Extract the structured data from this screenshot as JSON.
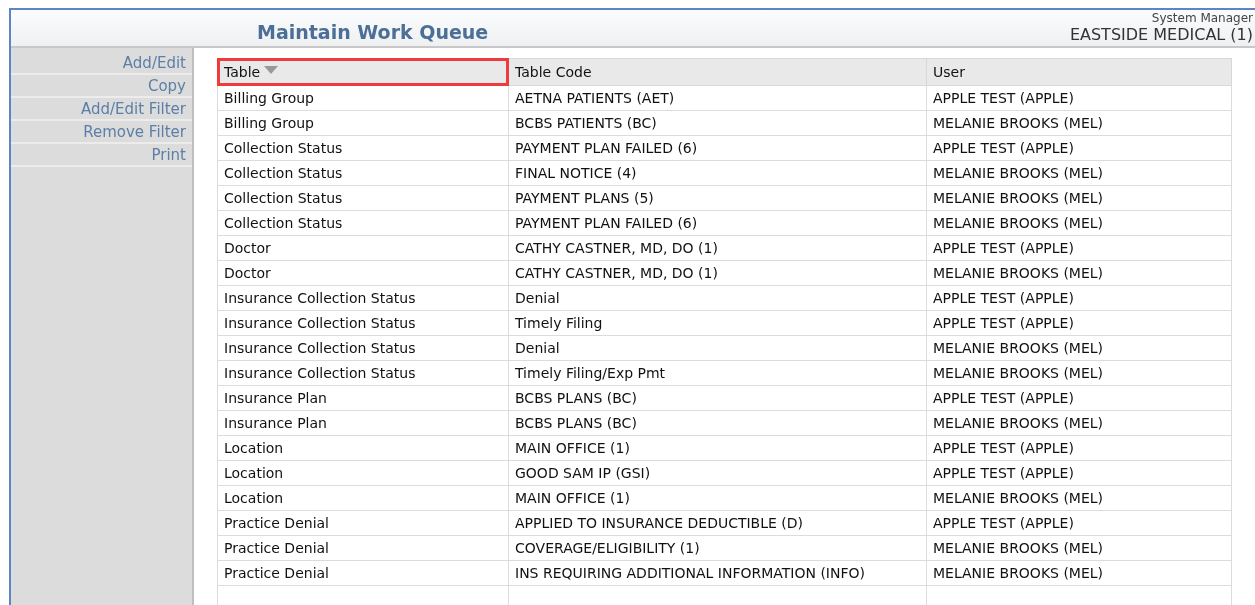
{
  "header": {
    "title": "Maintain Work Queue",
    "role": "System Manager",
    "practice": "EASTSIDE MEDICAL (1)"
  },
  "sidebar": {
    "items": [
      {
        "label": "Add/Edit"
      },
      {
        "label": "Copy"
      },
      {
        "label": "Add/Edit Filter"
      },
      {
        "label": "Remove Filter"
      },
      {
        "label": "Print"
      }
    ]
  },
  "table": {
    "columns": [
      {
        "label": "Table",
        "sorted": true,
        "highlighted": true
      },
      {
        "label": "Table Code",
        "sorted": false,
        "highlighted": false
      },
      {
        "label": "User",
        "sorted": false,
        "highlighted": false
      }
    ],
    "rows": [
      [
        "Billing Group",
        "AETNA PATIENTS (AET)",
        "APPLE TEST (APPLE)"
      ],
      [
        "Billing Group",
        "BCBS PATIENTS (BC)",
        "MELANIE BROOKS (MEL)"
      ],
      [
        "Collection Status",
        "PAYMENT PLAN FAILED (6)",
        "APPLE TEST (APPLE)"
      ],
      [
        "Collection Status",
        "FINAL NOTICE (4)",
        "MELANIE BROOKS (MEL)"
      ],
      [
        "Collection Status",
        "PAYMENT PLANS (5)",
        "MELANIE BROOKS (MEL)"
      ],
      [
        "Collection Status",
        "PAYMENT PLAN FAILED (6)",
        "MELANIE BROOKS (MEL)"
      ],
      [
        "Doctor",
        "CATHY CASTNER, MD, DO (1)",
        "APPLE TEST (APPLE)"
      ],
      [
        "Doctor",
        "CATHY CASTNER, MD, DO (1)",
        "MELANIE BROOKS (MEL)"
      ],
      [
        "Insurance Collection Status",
        "Denial",
        "APPLE TEST (APPLE)"
      ],
      [
        "Insurance Collection Status",
        "Timely Filing",
        "APPLE TEST (APPLE)"
      ],
      [
        "Insurance Collection Status",
        "Denial",
        "MELANIE BROOKS (MEL)"
      ],
      [
        "Insurance Collection Status",
        "Timely Filing/Exp Pmt",
        "MELANIE BROOKS (MEL)"
      ],
      [
        "Insurance Plan",
        "BCBS PLANS (BC)",
        "APPLE TEST (APPLE)"
      ],
      [
        "Insurance Plan",
        "BCBS PLANS (BC)",
        "MELANIE BROOKS (MEL)"
      ],
      [
        "Location",
        "MAIN OFFICE (1)",
        "APPLE TEST (APPLE)"
      ],
      [
        "Location",
        "GOOD SAM IP (GSI)",
        "APPLE TEST (APPLE)"
      ],
      [
        "Location",
        "MAIN OFFICE (1)",
        "MELANIE BROOKS (MEL)"
      ],
      [
        "Practice Denial",
        "APPLIED TO INSURANCE DEDUCTIBLE (D)",
        "APPLE TEST (APPLE)"
      ],
      [
        "Practice Denial",
        "COVERAGE/ELIGIBILITY (1)",
        "MELANIE BROOKS (MEL)"
      ],
      [
        "Practice Denial",
        "INS REQUIRING ADDITIONAL INFORMATION (INFO)",
        "MELANIE BROOKS (MEL)"
      ]
    ]
  }
}
